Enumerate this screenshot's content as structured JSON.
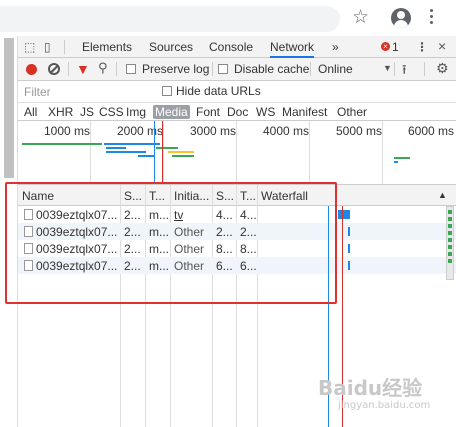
{
  "browser": {
    "icons": [
      "star-icon",
      "profile-icon",
      "kebab-menu-icon"
    ]
  },
  "devtools": {
    "tabs": [
      {
        "label": "Elements",
        "active": false
      },
      {
        "label": "Sources",
        "active": false
      },
      {
        "label": "Console",
        "active": false
      },
      {
        "label": "Network",
        "active": true
      }
    ],
    "more_tabs": "»",
    "error_count": "1",
    "error_icon_glyph": "×",
    "menu_glyph": "⋮",
    "close_glyph": "×",
    "toolbar": {
      "preserve_log": "Preserve log",
      "disable_cache": "Disable cache",
      "throttling": "Online"
    },
    "filter": {
      "placeholder": "Filter",
      "hide_data_urls": "Hide data URLs"
    },
    "types": [
      {
        "label": "All",
        "active": false
      },
      {
        "label": "XHR",
        "active": false
      },
      {
        "label": "JS",
        "active": false
      },
      {
        "label": "CSS",
        "active": false
      },
      {
        "label": "Img",
        "active": false
      },
      {
        "label": "Media",
        "active": true
      },
      {
        "label": "Font",
        "active": false
      },
      {
        "label": "Doc",
        "active": false
      },
      {
        "label": "WS",
        "active": false
      },
      {
        "label": "Manifest",
        "active": false
      },
      {
        "label": "Other",
        "active": false
      }
    ],
    "overview_ticks": [
      "1000 ms",
      "2000 ms",
      "3000 ms",
      "4000 ms",
      "5000 ms",
      "6000 ms"
    ],
    "table": {
      "columns": [
        "Name",
        "S...",
        "T...",
        "Initia...",
        "S...",
        "T...",
        "Waterfall"
      ],
      "sort_glyph": "▲",
      "rows": [
        {
          "name": "0039eztqlx07...",
          "status": "2...",
          "type": "m...",
          "initiator": "tv",
          "size": "4...",
          "time": "4..."
        },
        {
          "name": "0039eztqlx07...",
          "status": "2...",
          "type": "m...",
          "initiator": "Other",
          "size": "2...",
          "time": "2..."
        },
        {
          "name": "0039eztqlx07...",
          "status": "2...",
          "type": "m...",
          "initiator": "Other",
          "size": "8...",
          "time": "8..."
        },
        {
          "name": "0039eztqlx07...",
          "status": "2...",
          "type": "m...",
          "initiator": "Other",
          "size": "6...",
          "time": "6..."
        }
      ]
    }
  },
  "colors": {
    "accent": "#1a73e8",
    "record": "#d93025",
    "highlight_box": "#e03131",
    "waterfall_bar": "#1e88e5",
    "load_line": "#d32f2f"
  },
  "watermark": {
    "logo": "Baidu经验",
    "sub": "jingyan.baidu.com"
  }
}
